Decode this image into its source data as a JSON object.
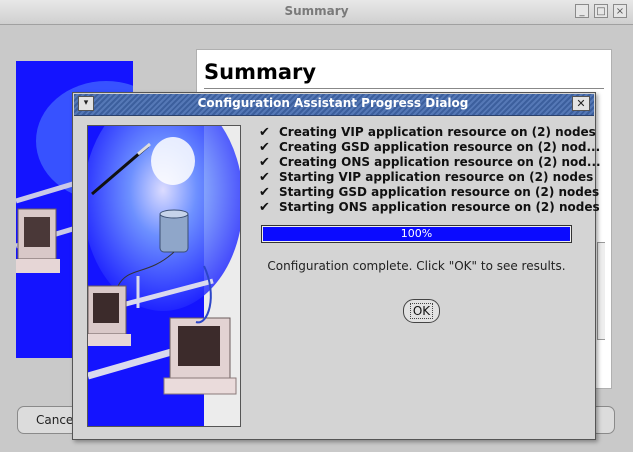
{
  "background_window": {
    "title": "Summary",
    "controls": {
      "minimize": "_",
      "maximize": "□",
      "close": "×"
    },
    "summary_heading": "Summary",
    "cancel_label": "Cance"
  },
  "dialog": {
    "title": "Configuration Assistant Progress Dialog",
    "menu_glyph": "▾",
    "close_glyph": "✕",
    "tasks": [
      {
        "check": "✔",
        "label": "Creating VIP application resource on (2) nodes"
      },
      {
        "check": "✔",
        "label": "Creating GSD application resource on (2) nod..."
      },
      {
        "check": "✔",
        "label": "Creating ONS application resource on (2) nod..."
      },
      {
        "check": "✔",
        "label": "Starting VIP application resource on (2) nodes"
      },
      {
        "check": "✔",
        "label": "Starting GSD application resource on (2) nodes"
      },
      {
        "check": "✔",
        "label": "Starting ONS application resource on (2) nodes"
      }
    ],
    "progress": {
      "percent": 100,
      "label": "100%"
    },
    "status_message": "Configuration complete. Click \"OK\" to see results.",
    "ok_label": "OK"
  },
  "colors": {
    "progress_fill": "#0b0bff",
    "titlebar": "#3c5f9d",
    "illustration_blue": "#1414ff"
  }
}
